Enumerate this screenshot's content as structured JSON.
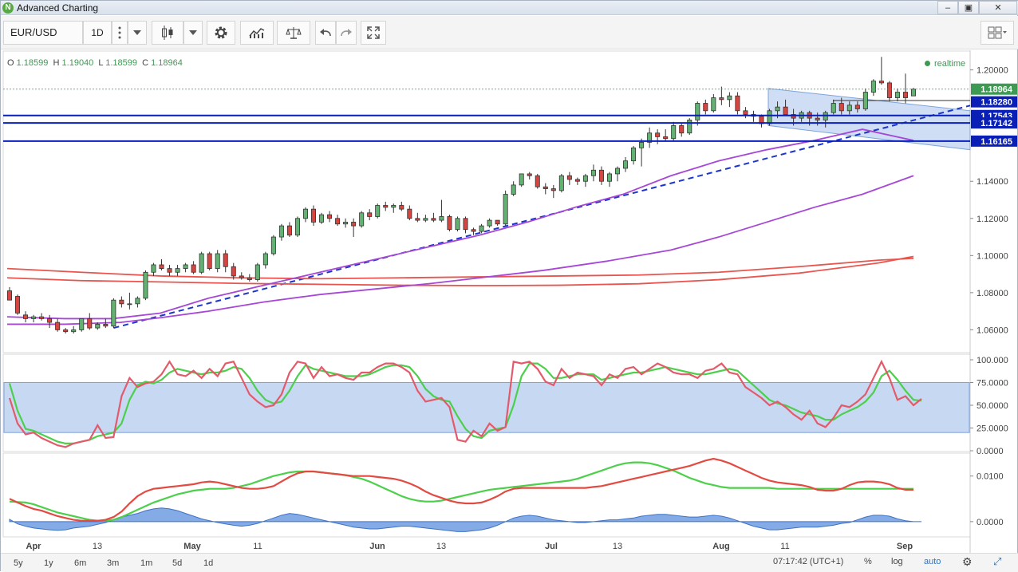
{
  "window": {
    "title": "Advanced Charting",
    "app_icon": "N"
  },
  "toolbar": {
    "symbol": "EUR/USD",
    "interval": "1D",
    "icons": [
      "more-vertical-icon",
      "dropdown-icon",
      "candlestick-icon",
      "settings-icon",
      "indicators-icon",
      "compare-icon",
      "undo-icon",
      "redo-icon",
      "fullscreen-icon",
      "layout-icon"
    ]
  },
  "ohlc": {
    "o_label": "O",
    "o": "1.18599",
    "h_label": "H",
    "h": "1.19040",
    "l_label": "L",
    "l": "1.18599",
    "c_label": "C",
    "c": "1.18964"
  },
  "realtime_label": "realtime",
  "price_axis": {
    "ticks": [
      "1.20000",
      "1.14000",
      "1.12000",
      "1.10000",
      "1.08000",
      "1.06000"
    ],
    "badges": [
      {
        "text": "1.18964",
        "color": "#3d9a52"
      },
      {
        "text": "1.18280",
        "color": "#0a1fb5"
      },
      {
        "text": "1.17543",
        "color": "#0a1fb5"
      },
      {
        "text": "1.17142",
        "color": "#0a1fb5"
      },
      {
        "text": "1.16165",
        "color": "#0a1fb5"
      }
    ]
  },
  "stoch_axis": {
    "ticks": [
      "100.000",
      "75.0000",
      "50.0000",
      "25.0000",
      "0.0000"
    ]
  },
  "macd_axis": {
    "ticks": [
      "0.0100",
      "0.0000"
    ]
  },
  "time_axis": {
    "labels": [
      "Apr",
      "13",
      "May",
      "11",
      "Jun",
      "13",
      "Jul",
      "13",
      "Aug",
      "11",
      "Sep"
    ]
  },
  "bottom": {
    "ranges": [
      "5y",
      "1y",
      "6m",
      "3m",
      "1m",
      "5d",
      "1d"
    ],
    "clock": "07:17:42 (UTC+1)",
    "percent": "%",
    "log": "log",
    "auto": "auto"
  },
  "chart_data": {
    "type": "candlestick",
    "symbol": "EUR/USD",
    "interval": "1D",
    "price_range": [
      1.049,
      1.208
    ],
    "horizontal_levels": [
      1.1828,
      1.17543,
      1.17142,
      1.16165
    ],
    "last_price": 1.18964,
    "candles": [
      [
        1.081,
        1.083,
        1.078,
        1.076
      ],
      [
        1.078,
        1.079,
        1.068,
        1.069
      ],
      [
        1.068,
        1.07,
        1.064,
        1.066
      ],
      [
        1.066,
        1.068,
        1.064,
        1.067
      ],
      [
        1.067,
        1.069,
        1.065,
        1.066
      ],
      [
        1.066,
        1.068,
        1.061,
        1.064
      ],
      [
        1.064,
        1.066,
        1.059,
        1.06
      ],
      [
        1.06,
        1.061,
        1.058,
        1.059
      ],
      [
        1.059,
        1.062,
        1.058,
        1.06
      ],
      [
        1.06,
        1.066,
        1.059,
        1.066
      ],
      [
        1.066,
        1.069,
        1.06,
        1.061
      ],
      [
        1.061,
        1.064,
        1.06,
        1.063
      ],
      [
        1.063,
        1.066,
        1.061,
        1.062
      ],
      [
        1.062,
        1.077,
        1.061,
        1.076
      ],
      [
        1.076,
        1.078,
        1.072,
        1.074
      ],
      [
        1.074,
        1.08,
        1.071,
        1.074
      ],
      [
        1.074,
        1.078,
        1.072,
        1.077
      ],
      [
        1.077,
        1.092,
        1.076,
        1.091
      ],
      [
        1.091,
        1.096,
        1.089,
        1.095
      ],
      [
        1.095,
        1.098,
        1.092,
        1.093
      ],
      [
        1.093,
        1.095,
        1.089,
        1.091
      ],
      [
        1.091,
        1.095,
        1.089,
        1.093
      ],
      [
        1.093,
        1.096,
        1.091,
        1.095
      ],
      [
        1.095,
        1.097,
        1.09,
        1.091
      ],
      [
        1.091,
        1.102,
        1.09,
        1.101
      ],
      [
        1.101,
        1.102,
        1.092,
        1.093
      ],
      [
        1.093,
        1.103,
        1.091,
        1.101
      ],
      [
        1.101,
        1.103,
        1.091,
        1.094
      ],
      [
        1.094,
        1.096,
        1.087,
        1.089
      ],
      [
        1.089,
        1.091,
        1.087,
        1.088
      ],
      [
        1.088,
        1.09,
        1.086,
        1.087
      ],
      [
        1.087,
        1.096,
        1.086,
        1.095
      ],
      [
        1.095,
        1.102,
        1.093,
        1.101
      ],
      [
        1.101,
        1.111,
        1.1,
        1.11
      ],
      [
        1.11,
        1.117,
        1.108,
        1.116
      ],
      [
        1.116,
        1.118,
        1.11,
        1.111
      ],
      [
        1.111,
        1.121,
        1.11,
        1.12
      ],
      [
        1.12,
        1.126,
        1.118,
        1.125
      ],
      [
        1.125,
        1.127,
        1.116,
        1.118
      ],
      [
        1.118,
        1.123,
        1.117,
        1.122
      ],
      [
        1.122,
        1.124,
        1.118,
        1.12
      ],
      [
        1.12,
        1.122,
        1.116,
        1.117
      ],
      [
        1.117,
        1.12,
        1.115,
        1.118
      ],
      [
        1.118,
        1.12,
        1.11,
        1.116
      ],
      [
        1.116,
        1.124,
        1.115,
        1.123
      ],
      [
        1.123,
        1.125,
        1.119,
        1.121
      ],
      [
        1.121,
        1.128,
        1.12,
        1.127
      ],
      [
        1.127,
        1.129,
        1.124,
        1.126
      ],
      [
        1.126,
        1.128,
        1.123,
        1.127
      ],
      [
        1.127,
        1.129,
        1.124,
        1.125
      ],
      [
        1.125,
        1.127,
        1.119,
        1.12
      ],
      [
        1.12,
        1.123,
        1.118,
        1.119
      ],
      [
        1.119,
        1.122,
        1.118,
        1.12
      ],
      [
        1.12,
        1.123,
        1.118,
        1.119
      ],
      [
        1.119,
        1.13,
        1.118,
        1.121
      ],
      [
        1.121,
        1.122,
        1.113,
        1.114
      ],
      [
        1.114,
        1.121,
        1.113,
        1.12
      ],
      [
        1.12,
        1.121,
        1.112,
        1.114
      ],
      [
        1.114,
        1.115,
        1.111,
        1.113
      ],
      [
        1.113,
        1.117,
        1.112,
        1.116
      ],
      [
        1.116,
        1.12,
        1.115,
        1.119
      ],
      [
        1.119,
        1.119,
        1.116,
        1.117
      ],
      [
        1.117,
        1.135,
        1.116,
        1.133
      ],
      [
        1.133,
        1.14,
        1.132,
        1.138
      ],
      [
        1.138,
        1.144,
        1.137,
        1.144
      ],
      [
        1.144,
        1.145,
        1.141,
        1.143
      ],
      [
        1.143,
        1.144,
        1.136,
        1.137
      ],
      [
        1.137,
        1.139,
        1.133,
        1.136
      ],
      [
        1.136,
        1.138,
        1.131,
        1.135
      ],
      [
        1.135,
        1.144,
        1.134,
        1.143
      ],
      [
        1.143,
        1.145,
        1.138,
        1.141
      ],
      [
        1.141,
        1.142,
        1.138,
        1.14
      ],
      [
        1.14,
        1.144,
        1.137,
        1.143
      ],
      [
        1.143,
        1.149,
        1.14,
        1.146
      ],
      [
        1.146,
        1.148,
        1.138,
        1.14
      ],
      [
        1.14,
        1.145,
        1.137,
        1.144
      ],
      [
        1.144,
        1.148,
        1.14,
        1.147
      ],
      [
        1.147,
        1.153,
        1.145,
        1.151
      ],
      [
        1.151,
        1.159,
        1.149,
        1.158
      ],
      [
        1.158,
        1.163,
        1.148,
        1.161
      ],
      [
        1.161,
        1.169,
        1.158,
        1.166
      ],
      [
        1.166,
        1.168,
        1.16,
        1.164
      ],
      [
        1.164,
        1.168,
        1.162,
        1.163
      ],
      [
        1.163,
        1.172,
        1.162,
        1.17
      ],
      [
        1.17,
        1.171,
        1.164,
        1.166
      ],
      [
        1.166,
        1.174,
        1.165,
        1.173
      ],
      [
        1.173,
        1.183,
        1.17,
        1.182
      ],
      [
        1.182,
        1.184,
        1.176,
        1.178
      ],
      [
        1.178,
        1.187,
        1.177,
        1.185
      ],
      [
        1.185,
        1.191,
        1.181,
        1.184
      ],
      [
        1.184,
        1.188,
        1.18,
        1.186
      ],
      [
        1.186,
        1.188,
        1.176,
        1.178
      ],
      [
        1.178,
        1.18,
        1.174,
        1.176
      ],
      [
        1.176,
        1.178,
        1.172,
        1.175
      ],
      [
        1.175,
        1.176,
        1.169,
        1.171
      ],
      [
        1.171,
        1.179,
        1.17,
        1.178
      ],
      [
        1.178,
        1.183,
        1.174,
        1.18
      ],
      [
        1.18,
        1.184,
        1.176,
        1.176
      ],
      [
        1.176,
        1.179,
        1.17,
        1.174
      ],
      [
        1.174,
        1.178,
        1.172,
        1.177
      ],
      [
        1.177,
        1.178,
        1.17,
        1.174
      ],
      [
        1.174,
        1.177,
        1.17,
        1.173
      ],
      [
        1.173,
        1.178,
        1.169,
        1.177
      ],
      [
        1.177,
        1.184,
        1.176,
        1.182
      ],
      [
        1.182,
        1.185,
        1.176,
        1.178
      ],
      [
        1.178,
        1.183,
        1.176,
        1.181
      ],
      [
        1.181,
        1.183,
        1.177,
        1.179
      ],
      [
        1.179,
        1.19,
        1.178,
        1.188
      ],
      [
        1.188,
        1.195,
        1.186,
        1.194
      ],
      [
        1.194,
        1.207,
        1.192,
        1.193
      ],
      [
        1.193,
        1.194,
        1.183,
        1.185
      ],
      [
        1.185,
        1.19,
        1.183,
        1.188
      ],
      [
        1.188,
        1.198,
        1.182,
        1.185
      ],
      [
        1.186,
        1.1904,
        1.186,
        1.1896
      ]
    ],
    "indicators": {
      "stochastic": {
        "range": [
          0,
          100
        ],
        "overbought": 75,
        "oversold": 20
      },
      "macd": {
        "range": [
          -0.003,
          0.0145
        ]
      }
    }
  }
}
